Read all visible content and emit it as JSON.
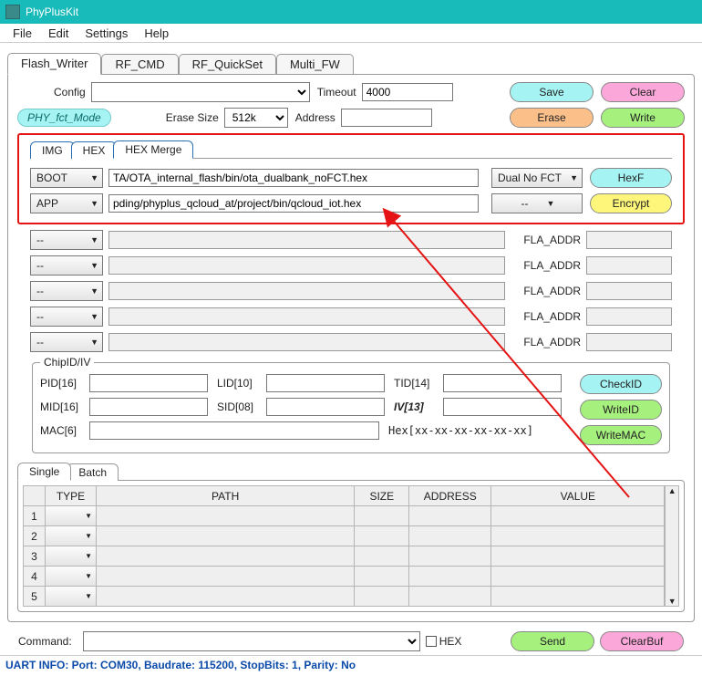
{
  "window": {
    "title": "PhyPlusKit"
  },
  "menu": {
    "file": "File",
    "edit": "Edit",
    "settings": "Settings",
    "help": "Help"
  },
  "outer_tabs": {
    "flash_writer": "Flash_Writer",
    "rf_cmd": "RF_CMD",
    "rf_quickset": "RF_QuickSet",
    "multi_fw": "Multi_FW"
  },
  "config_row": {
    "config_label": "Config",
    "timeout_label": "Timeout",
    "timeout_value": "4000",
    "save": "Save",
    "clear": "Clear"
  },
  "erase_row": {
    "phy_badge": "PHY_fct_Mode",
    "erase_size_label": "Erase Size",
    "erase_size_value": "512k",
    "address_label": "Address",
    "erase": "Erase",
    "write": "Write"
  },
  "inner_tabs": {
    "img": "IMG",
    "hex": "HEX",
    "hex_merge": "HEX Merge"
  },
  "hex_merge": {
    "row1": {
      "type": "BOOT",
      "path": "TA/OTA_internal_flash/bin/ota_dualbank_noFCT.hex",
      "mode": "Dual No FCT",
      "btn": "HexF"
    },
    "row2": {
      "type": "APP",
      "path": "pding/phyplus_qcloud_at/project/bin/qcloud_iot.hex",
      "mode": "--",
      "btn": "Encrypt"
    },
    "blank_type": "--",
    "fla_addr": "FLA_ADDR"
  },
  "chip": {
    "legend": "ChipID/IV",
    "pid": "PID[16]",
    "lid": "LID[10]",
    "tid": "TID[14]",
    "mid": "MID[16]",
    "sid": "SID[08]",
    "iv": "IV[13]",
    "mac": "MAC[6]",
    "hex_mask": "Hex[xx-xx-xx-xx-xx-xx]",
    "check_id": "CheckID",
    "write_id": "WriteID",
    "write_mac": "WriteMAC"
  },
  "single_batch": {
    "single": "Single",
    "batch": "Batch",
    "cols": {
      "type": "TYPE",
      "path": "PATH",
      "size": "SIZE",
      "address": "ADDRESS",
      "value": "VALUE"
    }
  },
  "command_row": {
    "label": "Command:",
    "hex": "HEX",
    "send": "Send",
    "clearbuf": "ClearBuf"
  },
  "status": "UART INFO: Port: COM30, Baudrate: 115200, StopBits: 1, Parity: No"
}
